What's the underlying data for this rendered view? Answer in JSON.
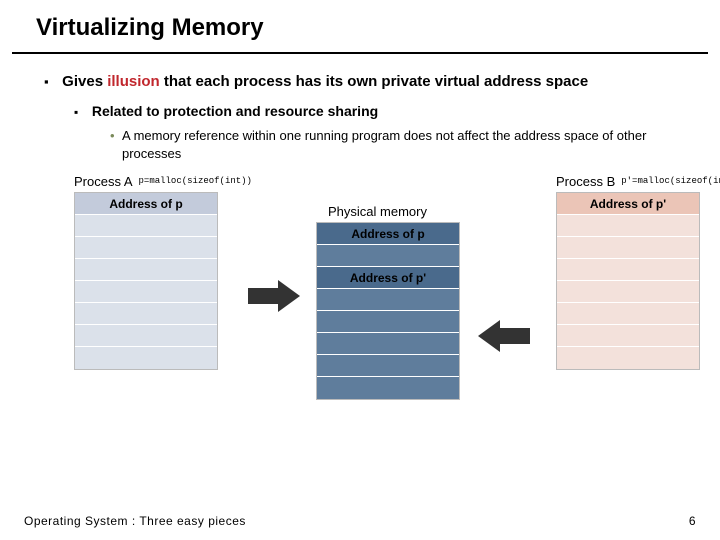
{
  "title": "Virtualizing Memory",
  "b1": {
    "line": "Gives illusion that each process has its own private virtual address space",
    "pre": "Gives ",
    "illusion": "illusion",
    "post": " that each process has its own private virtual address space"
  },
  "b2": "Related to protection and resource sharing",
  "b3": "A memory reference within one running program does not affect the address space of other processes",
  "procA": {
    "label": "Process A",
    "code": "p=malloc(sizeof(int))",
    "hdr": "Address of p"
  },
  "procB": {
    "label": "Process B",
    "code": "p'=malloc(sizeof(int))",
    "hdr": "Address of p'"
  },
  "phys": {
    "label": "Physical memory",
    "row1": "Address of p",
    "row2": "Address of p'"
  },
  "footer": {
    "left": "Operating System : Three easy pieces",
    "page": "6"
  }
}
